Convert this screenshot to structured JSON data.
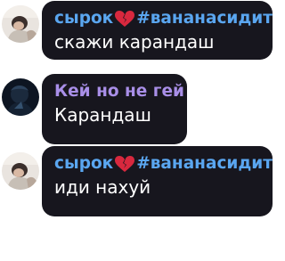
{
  "accent_colors": {
    "name_blue": "#5aa6f0",
    "name_purple": "#a98fe8",
    "bubble_bg": "#17161e",
    "text": "#ffffff"
  },
  "messages": [
    {
      "sender_part1": "сырок",
      "sender_icon": "broken-heart-icon",
      "sender_part2": "#вананасидите",
      "text": "скажи карандаш"
    },
    {
      "sender": "Кей но не гей",
      "text": "Карандаш"
    },
    {
      "sender_part1": "сырок",
      "sender_icon": "broken-heart-icon",
      "sender_part2": "#вананасидите",
      "text": "иди нахуй"
    }
  ]
}
